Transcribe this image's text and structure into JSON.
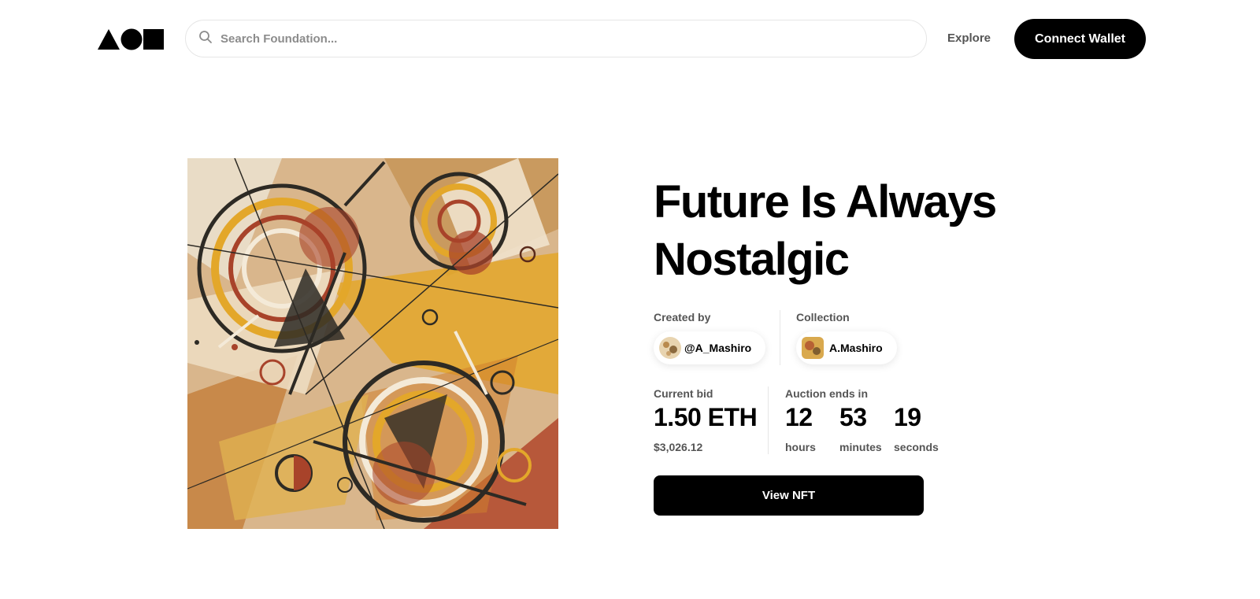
{
  "header": {
    "logo_icon": "foundation-logo-icon",
    "search": {
      "placeholder": "Search Foundation...",
      "icon": "search-icon"
    },
    "explore_label": "Explore",
    "connect_label": "Connect Wallet"
  },
  "artwork": {
    "icon": "abstract-artwork-image",
    "colors": {
      "background": "#d9b68c",
      "accent": "#e3a72a",
      "rust": "#a8432a",
      "dark": "#2d2a24"
    }
  },
  "nft": {
    "title": "Future Is Always Nostalgic",
    "created_by_label": "Created by",
    "creator": "@A_Mashiro",
    "collection_label": "Collection",
    "collection": "A.Mashiro",
    "current_bid_label": "Current bid",
    "current_bid": "1.50 ETH",
    "current_bid_usd": "$3,026.12",
    "auction_label": "Auction ends in",
    "countdown": [
      {
        "value": "12",
        "unit": "hours"
      },
      {
        "value": "53",
        "unit": "minutes"
      },
      {
        "value": "19",
        "unit": "seconds"
      }
    ],
    "view_label": "View NFT"
  }
}
